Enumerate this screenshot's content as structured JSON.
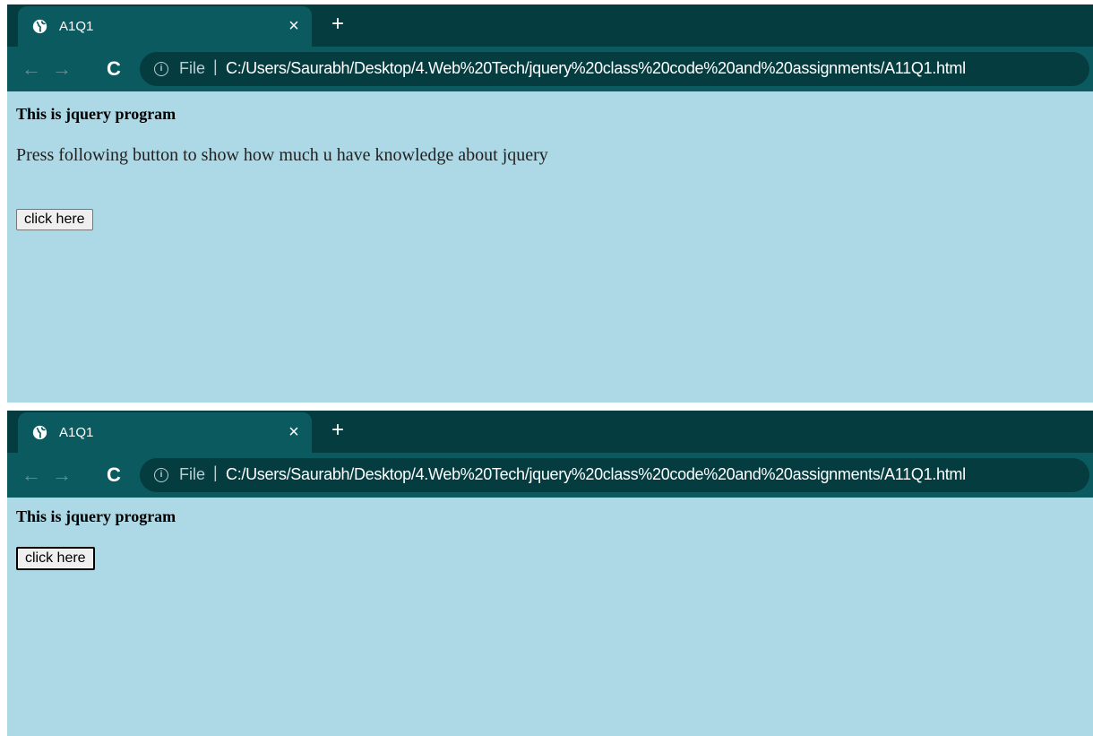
{
  "screenshots": [
    {
      "tab": {
        "title": "A1Q1",
        "close": "×",
        "new_tab": "+"
      },
      "toolbar": {
        "back": "←",
        "forward": "→",
        "reload": "C",
        "info_icon": "i",
        "scheme": "File",
        "separator": "|",
        "url": "C:/Users/Saurabh/Desktop/4.Web%20Tech/jquery%20class%20code%20and%20assignments/A11Q1.html"
      },
      "page": {
        "heading": "This is jquery program",
        "paragraph": "Press following button to show how much u have knowledge about jquery",
        "button": "click here"
      }
    },
    {
      "tab": {
        "title": "A1Q1",
        "close": "×",
        "new_tab": "+"
      },
      "toolbar": {
        "back": "←",
        "forward": "→",
        "reload": "C",
        "info_icon": "i",
        "scheme": "File",
        "separator": "|",
        "url": "C:/Users/Saurabh/Desktop/4.Web%20Tech/jquery%20class%20code%20and%20assignments/A11Q1.html"
      },
      "page": {
        "heading": "This is jquery program",
        "button": "click here"
      }
    }
  ],
  "colors": {
    "tabstrip": "#043c40",
    "toolbar": "#0b5a60",
    "page_background": "#add8e6"
  }
}
